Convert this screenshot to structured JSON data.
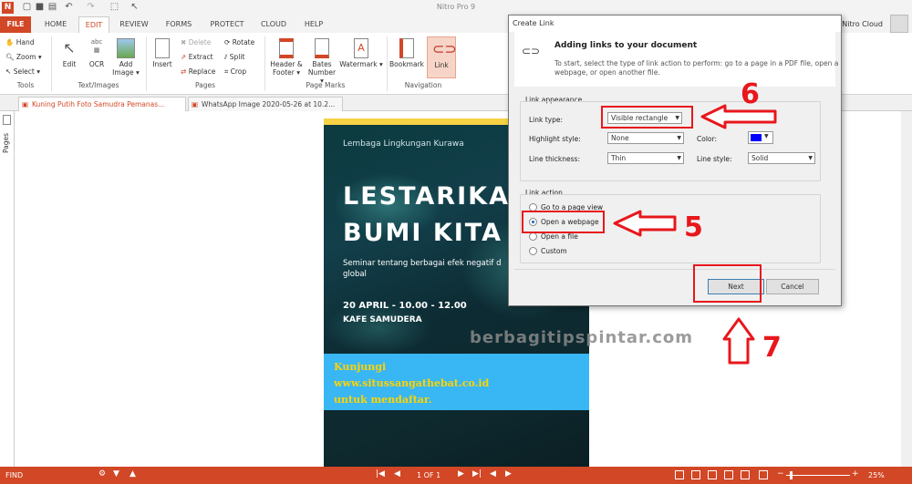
{
  "app": {
    "title": "Nitro Pro 9",
    "cloud_label": "Nitro Cloud"
  },
  "ribbon_tabs": [
    "FILE",
    "HOME",
    "EDIT",
    "REVIEW",
    "FORMS",
    "PROTECT",
    "CLOUD",
    "HELP"
  ],
  "ribbon": {
    "tools": {
      "hand": "Hand",
      "zoom": "Zoom",
      "select": "Select",
      "label": "Tools"
    },
    "text_images": {
      "edit": "Edit",
      "ocr": "OCR",
      "add_image_1": "Add",
      "add_image_2": "Image",
      "label": "Text/Images"
    },
    "pages": {
      "insert": "Insert",
      "delete": "Delete",
      "extract": "Extract",
      "replace": "Replace",
      "rotate": "Rotate",
      "split": "Split",
      "crop": "Crop",
      "label": "Pages"
    },
    "page_marks": {
      "header_1": "Header &",
      "header_2": "Footer",
      "bates_1": "Bates",
      "bates_2": "Number",
      "watermark": "Watermark",
      "label": "Page Marks"
    },
    "navigation": {
      "bookmark": "Bookmark",
      "link": "Link",
      "label": "Navigation"
    }
  },
  "doc_tabs": [
    {
      "label": "Kuning Putih Foto Samudra Pemanas..."
    },
    {
      "label": "WhatsApp Image 2020-05-26 at 10.2..."
    }
  ],
  "side_panel": {
    "label": "Pages"
  },
  "document": {
    "org": "Lembaga Lingkungan Kurawa",
    "headline_1": "LESTARIKA",
    "headline_2": "BUMI KITA",
    "subtitle_1": "Seminar tentang berbagai efek negatif d",
    "subtitle_2": "global",
    "date": "20 APRIL - 10.00 - 12.00",
    "venue": "KAFE SAMUDERA",
    "cta_1": "Kunjungi",
    "cta_2": "www.situssangathebat.co.id",
    "cta_3": "untuk mendaftar."
  },
  "watermark_text": "berbagitipspintar.com",
  "dialog": {
    "title": "Create Link",
    "heading": "Adding links to your document",
    "description_1": "To start, select the type of link action to perform: go to a page in a PDF file, open a",
    "description_2": "webpage, or open another file.",
    "appearance": {
      "legend": "Link appearance",
      "link_type_label": "Link type:",
      "link_type_value": "Visible rectangle",
      "highlight_label": "Highlight style:",
      "highlight_value": "None",
      "color_label": "Color:",
      "color_value": "#0000ff",
      "thickness_label": "Line thickness:",
      "thickness_value": "Thin",
      "line_style_label": "Line style:",
      "line_style_value": "Solid"
    },
    "action": {
      "legend": "Link action",
      "options": [
        "Go to a page view",
        "Open a webpage",
        "Open a file",
        "Custom"
      ],
      "selected": "Open a webpage"
    },
    "next_label": "Next",
    "cancel_label": "Cancel"
  },
  "annotations": {
    "step5": "5",
    "step6": "6",
    "step7": "7"
  },
  "status": {
    "find": "FIND",
    "page": "1 OF 1",
    "zoom": "25%"
  },
  "colors": {
    "brand": "#d24726",
    "annotation": "#e8171c",
    "accent_blue": "#39b6f4",
    "gold": "#f6d244"
  }
}
